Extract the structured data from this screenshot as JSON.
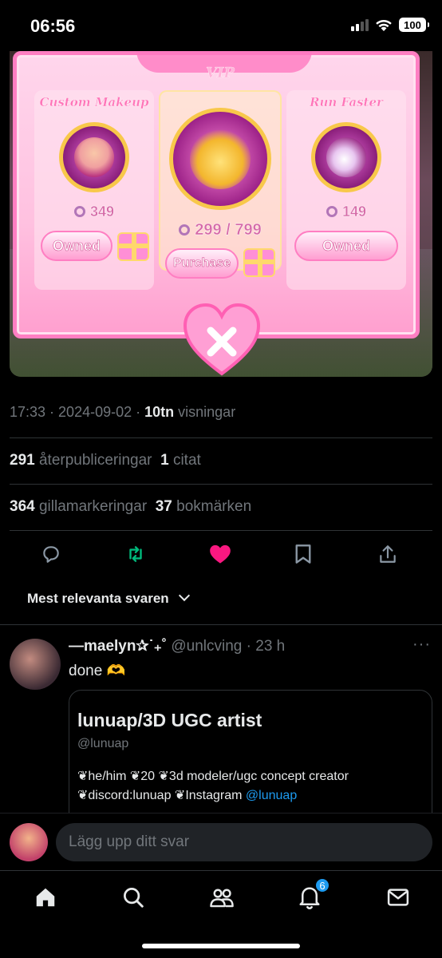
{
  "status": {
    "time": "06:56",
    "battery": "100"
  },
  "media": {
    "cards": [
      {
        "title": "Custom Makeup",
        "price": "349",
        "button": "Owned"
      },
      {
        "title": "VIP",
        "price": "299 / 799",
        "button": "Purchase"
      },
      {
        "title": "Run Faster",
        "price": "149",
        "button": "Owned"
      }
    ]
  },
  "post": {
    "time": "17:33",
    "date": "2024-09-02",
    "views_count": "10tn",
    "views_label": "visningar",
    "reposts_count": "291",
    "reposts_label": "återpubliceringar",
    "quotes_count": "1",
    "quotes_label": "citat",
    "likes_count": "364",
    "likes_label": "gillamarkeringar",
    "bookmarks_count": "37",
    "bookmarks_label": "bokmärken"
  },
  "colors": {
    "retweet": "#00ba7c",
    "like": "#f91880",
    "link": "#1d9bf0"
  },
  "sort_label": "Mest relevanta svaren",
  "reply": {
    "name": "—maelyn✰˙₊˚",
    "handle": "@unlcving",
    "age": "23 h",
    "text": "done 🫶",
    "embed": {
      "name": "lunuap/3D UGC artist",
      "handle": "@lunuap",
      "bio_line1": "❦he/him ❦20 ❦3d modeler/ugc concept creator",
      "bio_line2": "❦discord:lunuap ❦Instagram ",
      "bio_link": "@lunuap"
    }
  },
  "composer": {
    "placeholder": "Lägg upp ditt svar"
  },
  "nav": {
    "notifications_badge": "6"
  }
}
